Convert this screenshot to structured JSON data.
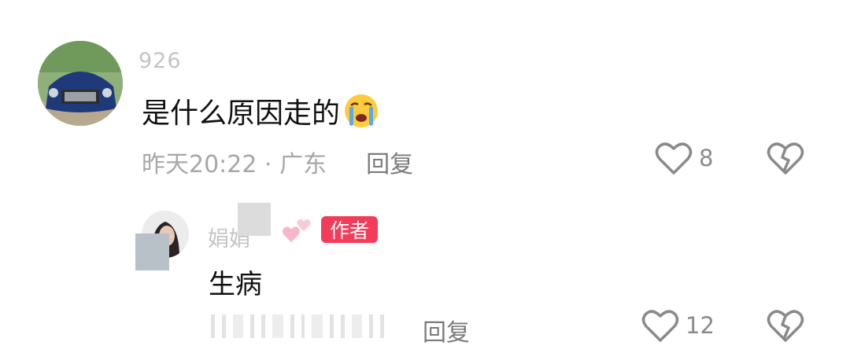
{
  "main_comment": {
    "username": "926",
    "text": "是什么原因走的",
    "emoji": "crying-face",
    "time_location": "昨天20:22 · 广东",
    "reply_label": "回复",
    "likes": "8"
  },
  "reply_comment": {
    "username": "娟娟",
    "author_badge": "作者",
    "text": "生病",
    "reply_label": "回复",
    "likes": "12"
  },
  "icons": {
    "like": "heart-outline-icon",
    "dislike": "broken-heart-icon"
  },
  "colors": {
    "badge": "#f23c5a",
    "meta_text": "#a7a7a7",
    "icon_gray": "#8a8a8a"
  }
}
